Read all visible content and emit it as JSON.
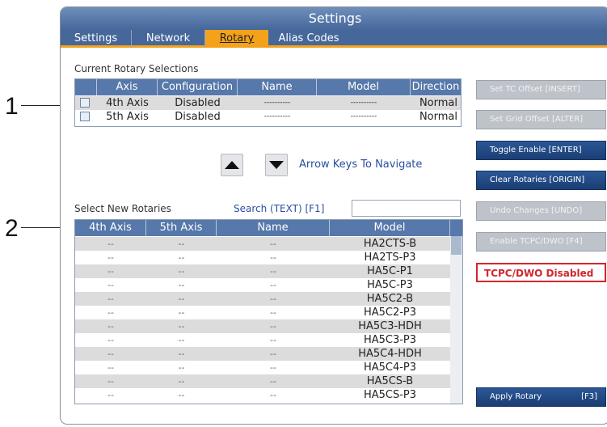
{
  "callouts": [
    "1",
    "2"
  ],
  "window": {
    "title": "Settings"
  },
  "tabs": [
    {
      "label": "Settings",
      "active": false
    },
    {
      "label": "Network",
      "active": false
    },
    {
      "label": "Rotary",
      "active": true
    },
    {
      "label": "Alias Codes",
      "active": false
    }
  ],
  "current": {
    "heading": "Current Rotary Selections",
    "columns": [
      "Axis",
      "Configuration",
      "Name",
      "Model",
      "Direction"
    ],
    "rows": [
      {
        "axis": "4th Axis",
        "configuration": "Disabled",
        "name": "----------",
        "model": "----------",
        "direction": "Normal"
      },
      {
        "axis": "5th Axis",
        "configuration": "Disabled",
        "name": "----------",
        "model": "----------",
        "direction": "Normal"
      }
    ]
  },
  "navigation": {
    "hint": "Arrow Keys To Navigate",
    "up_icon": "arrow-up-icon",
    "down_icon": "arrow-down-icon"
  },
  "select": {
    "heading": "Select New Rotaries",
    "search_label": "Search (TEXT) [F1]",
    "search_value": "",
    "columns": [
      "4th Axis",
      "5th Axis",
      "Name",
      "Model"
    ],
    "rows": [
      {
        "a4": "--",
        "a5": "--",
        "name": "--",
        "model": "HA2CTS-B"
      },
      {
        "a4": "--",
        "a5": "--",
        "name": "--",
        "model": "HA2TS-P3"
      },
      {
        "a4": "--",
        "a5": "--",
        "name": "--",
        "model": "HA5C-P1"
      },
      {
        "a4": "--",
        "a5": "--",
        "name": "--",
        "model": "HA5C-P3"
      },
      {
        "a4": "--",
        "a5": "--",
        "name": "--",
        "model": "HA5C2-B"
      },
      {
        "a4": "--",
        "a5": "--",
        "name": "--",
        "model": "HA5C2-P3"
      },
      {
        "a4": "--",
        "a5": "--",
        "name": "--",
        "model": "HA5C3-HDH"
      },
      {
        "a4": "--",
        "a5": "--",
        "name": "--",
        "model": "HA5C3-P3"
      },
      {
        "a4": "--",
        "a5": "--",
        "name": "--",
        "model": "HA5C4-HDH"
      },
      {
        "a4": "--",
        "a5": "--",
        "name": "--",
        "model": "HA5C4-P3"
      },
      {
        "a4": "--",
        "a5": "--",
        "name": "--",
        "model": "HA5CS-B"
      },
      {
        "a4": "--",
        "a5": "--",
        "name": "--",
        "model": "HA5CS-P3"
      }
    ]
  },
  "buttons": [
    {
      "label": "Set TC Offset [INSERT]",
      "state": "disabled"
    },
    {
      "label": "Set Grid Offset [ALTER]",
      "state": "disabled"
    },
    {
      "label": "Toggle Enable  [ENTER]",
      "state": "enabled"
    },
    {
      "label": "Clear Rotaries [ORIGIN]",
      "state": "enabled"
    },
    {
      "label": "Undo Changes [UNDO]",
      "state": "disabled"
    },
    {
      "label": "Enable TCPC/DWO [F4]",
      "state": "disabled"
    }
  ],
  "status": {
    "tcpc": "TCPC/DWO Disabled"
  },
  "apply": {
    "label": "Apply Rotary",
    "key": "[F3]"
  },
  "colors": {
    "header_blue": "#5678aa",
    "tab_orange": "#f4a21b",
    "button_blue": "#1b3e73",
    "warning_red": "#d1262d"
  }
}
